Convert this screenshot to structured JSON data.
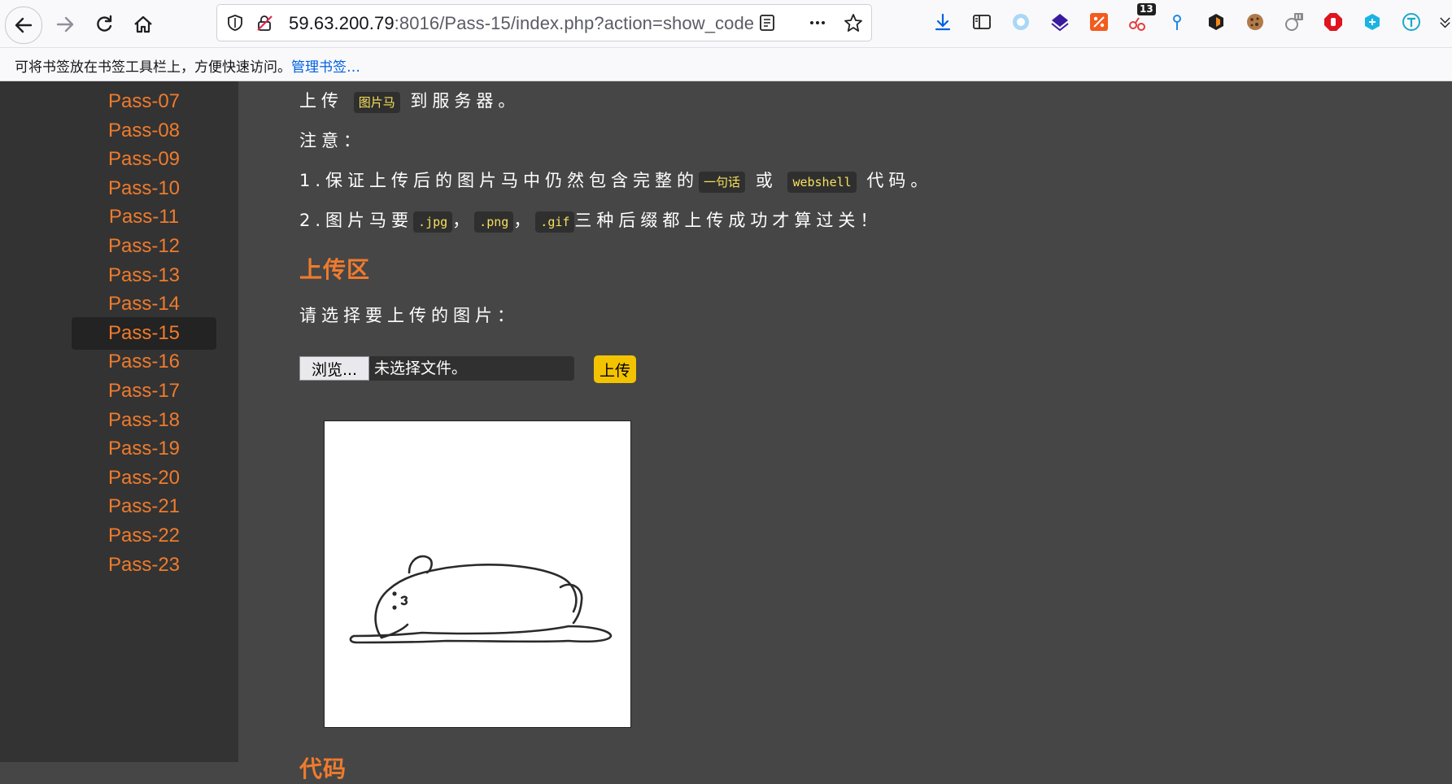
{
  "browser": {
    "url_host": "59.63.200.79",
    "url_rest": ":8016/Pass-15/index.php?action=show_code",
    "downloads_badge": "13"
  },
  "bookmarks": {
    "hint": "可将书签放在书签工具栏上，方便快速访问。",
    "manage_link": "管理书签…"
  },
  "sidebar": {
    "items": [
      "Pass-07",
      "Pass-08",
      "Pass-09",
      "Pass-10",
      "Pass-11",
      "Pass-12",
      "Pass-13",
      "Pass-14",
      "Pass-15",
      "Pass-16",
      "Pass-17",
      "Pass-18",
      "Pass-19",
      "Pass-20",
      "Pass-21",
      "Pass-22",
      "Pass-23"
    ],
    "active": "Pass-15"
  },
  "content": {
    "line1_pre": "上传",
    "line1_code": "图片马",
    "line1_post": "到服务器。",
    "note_label": "注意：",
    "note1_pre": "1.保证上传后的图片马中仍然包含完整的",
    "note1_code1": "一句话",
    "note1_mid": "或",
    "note1_code2": "webshell",
    "note1_post": "代码。",
    "note2_pre": "2.图片马要",
    "note2_code1": ".jpg",
    "note2_sep1": "，",
    "note2_code2": ".png",
    "note2_sep2": "，",
    "note2_code3": ".gif",
    "note2_post": "三种后缀都上传成功才算过关！",
    "upload_heading": "上传区",
    "select_prompt": "请选择要上传的图片：",
    "browse_label": "浏览...",
    "file_status": "未选择文件。",
    "upload_button": "上传",
    "next_heading": "代码"
  },
  "colors": {
    "accent_orange": "#ef7b2d",
    "code_yellow": "#f5e05b",
    "upload_button": "#f4c300",
    "page_bg": "#464646",
    "sidebar_bg": "#333333"
  }
}
